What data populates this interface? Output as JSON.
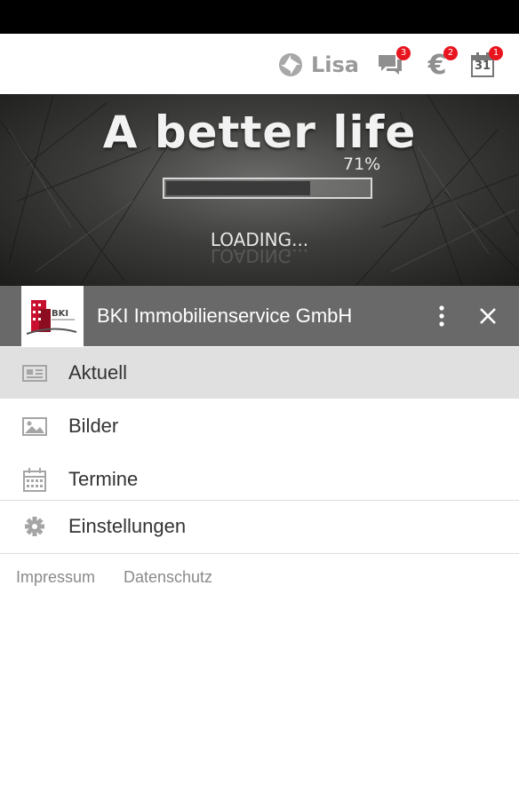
{
  "topbar": {
    "user_name": "Lisa",
    "messages_badge": "3",
    "payments_badge": "2",
    "calendar_badge": "1",
    "calendar_day": "31"
  },
  "banner": {
    "title": "A better life",
    "progress_text": "71%",
    "progress_value": 0.71,
    "loading_text": "LOADING..."
  },
  "drawer": {
    "company_name": "BKI Immobilienservice GmbH",
    "logo_text": "BKI"
  },
  "menu": {
    "items": [
      {
        "label": "Aktuell",
        "icon": "news-icon",
        "active": true
      },
      {
        "label": "Bilder",
        "icon": "image-icon",
        "active": false
      },
      {
        "label": "Termine",
        "icon": "calendar-icon",
        "active": false
      },
      {
        "label": "Einstellungen",
        "icon": "gear-icon",
        "active": false
      }
    ]
  },
  "footer": {
    "impressum": "Impressum",
    "datenschutz": "Datenschutz"
  },
  "colors": {
    "badge": "#e8141e",
    "header_bg": "#696969",
    "active_bg": "#e0e0e0"
  }
}
